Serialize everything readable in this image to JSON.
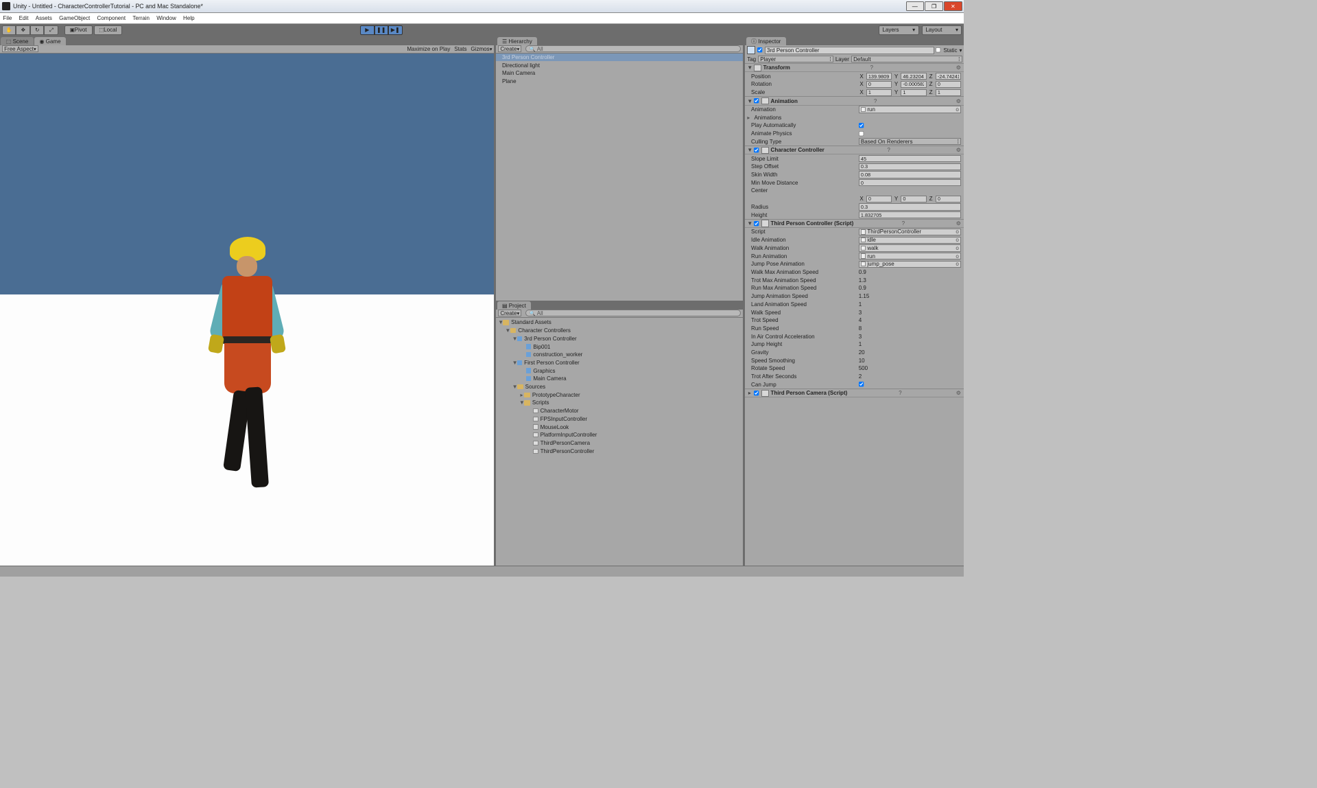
{
  "title": "Unity - Untitled - CharacterControllerTutorial - PC and Mac Standalone*",
  "menu": [
    "File",
    "Edit",
    "Assets",
    "GameObject",
    "Component",
    "Terrain",
    "Window",
    "Help"
  ],
  "toolbar": {
    "pivot": "Pivot",
    "local": "Local",
    "layers": "Layers",
    "layout": "Layout"
  },
  "game_toolbar": {
    "aspect": "Free Aspect",
    "maximize": "Maximize on Play",
    "stats": "Stats",
    "gizmos": "Gizmos"
  },
  "tabs": {
    "scene": "Scene",
    "game": "Game",
    "hierarchy": "Hierarchy",
    "project": "Project",
    "inspector": "Inspector"
  },
  "hierarchy": {
    "create": "Create",
    "search": "All",
    "items": [
      "3rd Person Controller",
      "Directional light",
      "Main Camera",
      "Plane"
    ]
  },
  "project": {
    "create": "Create",
    "search": "All",
    "root": "Standard Assets",
    "cc": "Character Controllers",
    "tpc": "3rd Person Controller",
    "bip": "Bip001",
    "worker": "construction_worker",
    "fpc": "First Person Controller",
    "graphics": "Graphics",
    "maincam": "Main Camera",
    "sources": "Sources",
    "proto": "PrototypeCharacter",
    "scripts": "Scripts",
    "s_items": [
      "CharacterMotor",
      "FPSInputController",
      "MouseLook",
      "PlatformInputController",
      "ThirdPersonCamera",
      "ThirdPersonController"
    ]
  },
  "inspector": {
    "name": "3rd Person Controller",
    "static": "Static",
    "tag_lbl": "Tag",
    "tag_val": "Player",
    "layer_lbl": "Layer",
    "layer_val": "Default",
    "transform": {
      "title": "Transform",
      "pos": "Position",
      "px": "139.9809",
      "py": "46.23204",
      "pz": "-24.74241",
      "rot": "Rotation",
      "rx": "0",
      "ry": "-0.0005828429",
      "rz": "0",
      "scl": "Scale",
      "sx": "1",
      "sy": "1",
      "sz": "1"
    },
    "animation": {
      "title": "Animation",
      "anim_lbl": "Animation",
      "anim_val": "run",
      "anims": "Animations",
      "play_auto": "Play Automatically",
      "phys": "Animate Physics",
      "cull": "Culling Type",
      "cull_val": "Based On Renderers"
    },
    "charctrl": {
      "title": "Character Controller",
      "slope": "Slope Limit",
      "slope_v": "45",
      "step": "Step Offset",
      "step_v": "0.3",
      "skin": "Skin Width",
      "skin_v": "0.08",
      "minmove": "Min Move Distance",
      "minmove_v": "0",
      "center": "Center",
      "cx": "0",
      "cy": "0",
      "cz": "0",
      "radius": "Radius",
      "radius_v": "0.3",
      "height": "Height",
      "height_v": "1.832705"
    },
    "tpcscript": {
      "title": "Third Person Controller (Script)",
      "script": "Script",
      "script_v": "ThirdPersonController",
      "idle": "Idle Animation",
      "idle_v": "idle",
      "walk": "Walk Animation",
      "walk_v": "walk",
      "run": "Run Animation",
      "run_v": "run",
      "jump": "Jump Pose Animation",
      "jump_v": "jump_pose",
      "wmas": "Walk Max Animation Speed",
      "wmas_v": "0.9",
      "tmas": "Trot Max Animation Speed",
      "tmas_v": "1.3",
      "rmas": "Run Max Animation Speed",
      "rmas_v": "0.9",
      "jas": "Jump Animation Speed",
      "jas_v": "1.15",
      "las": "Land Animation Speed",
      "las_v": "1",
      "ws": "Walk Speed",
      "ws_v": "3",
      "ts": "Trot Speed",
      "ts_v": "4",
      "rs": "Run Speed",
      "rs_v": "8",
      "iaca": "In Air Control Acceleration",
      "iaca_v": "3",
      "jh": "Jump Height",
      "jh_v": "1",
      "grav": "Gravity",
      "grav_v": "20",
      "ss": "Speed Smoothing",
      "ss_v": "10",
      "rots": "Rotate Speed",
      "rots_v": "500",
      "tas": "Trot After Seconds",
      "tas_v": "2",
      "cj": "Can Jump"
    },
    "tpcam": {
      "title": "Third Person Camera (Script)"
    }
  }
}
